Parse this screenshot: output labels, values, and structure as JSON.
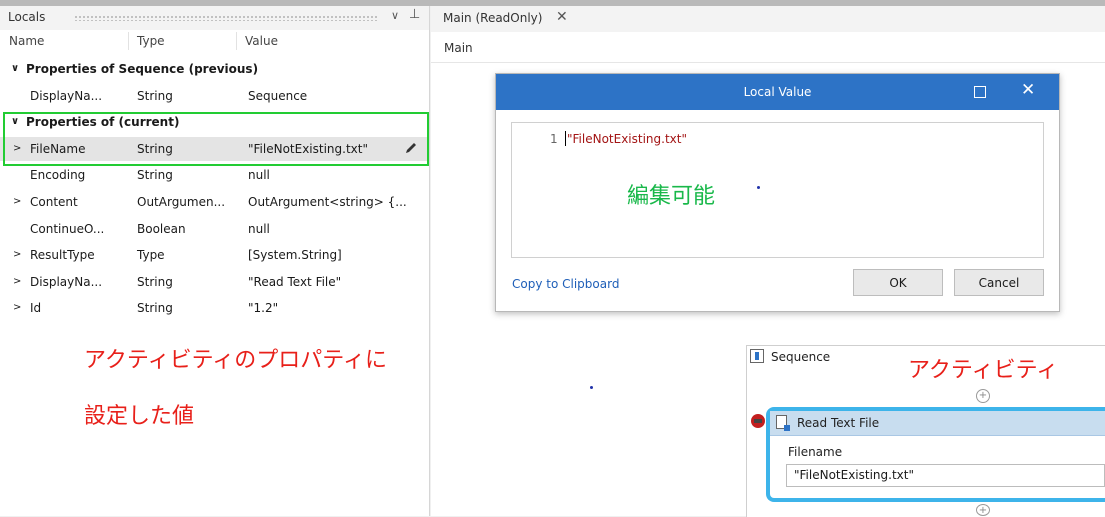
{
  "locals": {
    "title": "Locals",
    "chevron": "∨",
    "pin": "⊥",
    "columns": [
      "Name",
      "Type",
      "Value"
    ],
    "rows": [
      {
        "kind": "group",
        "expander": "∨",
        "name": "Properties of Sequence (previous)"
      },
      {
        "kind": "item",
        "expander": "",
        "name": "DisplayNa...",
        "type": "String",
        "value": "Sequence"
      },
      {
        "kind": "group",
        "expander": "∨",
        "name": "Properties of  (current)"
      },
      {
        "kind": "item",
        "expander": ">",
        "name": "FileName",
        "type": "String",
        "value": "\"FileNotExisting.txt\"",
        "selected": true
      },
      {
        "kind": "item",
        "expander": "",
        "name": "Encoding",
        "type": "String",
        "value": "null"
      },
      {
        "kind": "item",
        "expander": ">",
        "name": "Content",
        "type": "OutArgumen...",
        "value": "OutArgument<string> {..."
      },
      {
        "kind": "item",
        "expander": "",
        "name": "ContinueO...",
        "type": "Boolean",
        "value": "null"
      },
      {
        "kind": "item",
        "expander": ">",
        "name": "ResultType",
        "type": "Type",
        "value": "[System.String]"
      },
      {
        "kind": "item",
        "expander": ">",
        "name": "DisplayNa...",
        "type": "String",
        "value": "\"Read Text File\""
      },
      {
        "kind": "item",
        "expander": ">",
        "name": "Id",
        "type": "String",
        "value": "\"1.2\""
      }
    ]
  },
  "annotations": {
    "red_line1": "アクティビティのプロパティに",
    "red_line2": "設定した値",
    "green": "編集可能",
    "activity": "アクティビティ"
  },
  "designer": {
    "tab_label": "Main (ReadOnly)",
    "tab_close": "✕",
    "breadcrumb": "Main"
  },
  "dialog": {
    "title": "Local Value",
    "close": "✕",
    "line_number": "1",
    "code": "\"FileNotExisting.txt\"",
    "copy_link": "Copy to Clipboard",
    "ok": "OK",
    "cancel": "Cancel"
  },
  "workflow": {
    "sequence_label": "Sequence",
    "plus": "+",
    "activity_title": "Read Text File",
    "field_label": "Filename",
    "field_value": "\"FileNotExisting.txt\""
  },
  "colors": {
    "dialog_titlebar": "#2d73c6",
    "highlight_box": "#22cc33",
    "annotation_red": "#e8201a",
    "annotation_green": "#19b84a",
    "activity_border": "#3db4ea"
  }
}
